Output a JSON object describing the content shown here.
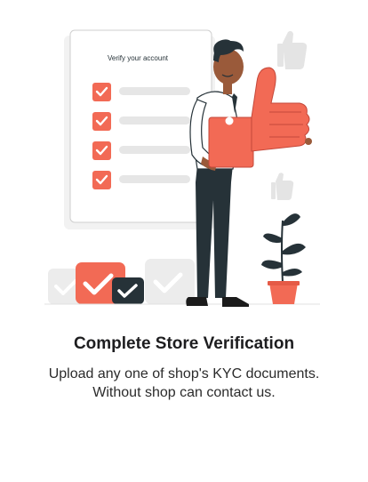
{
  "illustration": {
    "card_heading": "Verify your account",
    "checklist_count": 4,
    "colors": {
      "accent": "#F26A55",
      "dark": "#263238",
      "light_gray": "#EBEBEB",
      "skin": "#9A5A3A"
    }
  },
  "content": {
    "title": "Complete Store Verification",
    "subtitle_line1": "Upload any one of shop's KYC documents.",
    "subtitle_line2": "Without shop can contact us."
  }
}
